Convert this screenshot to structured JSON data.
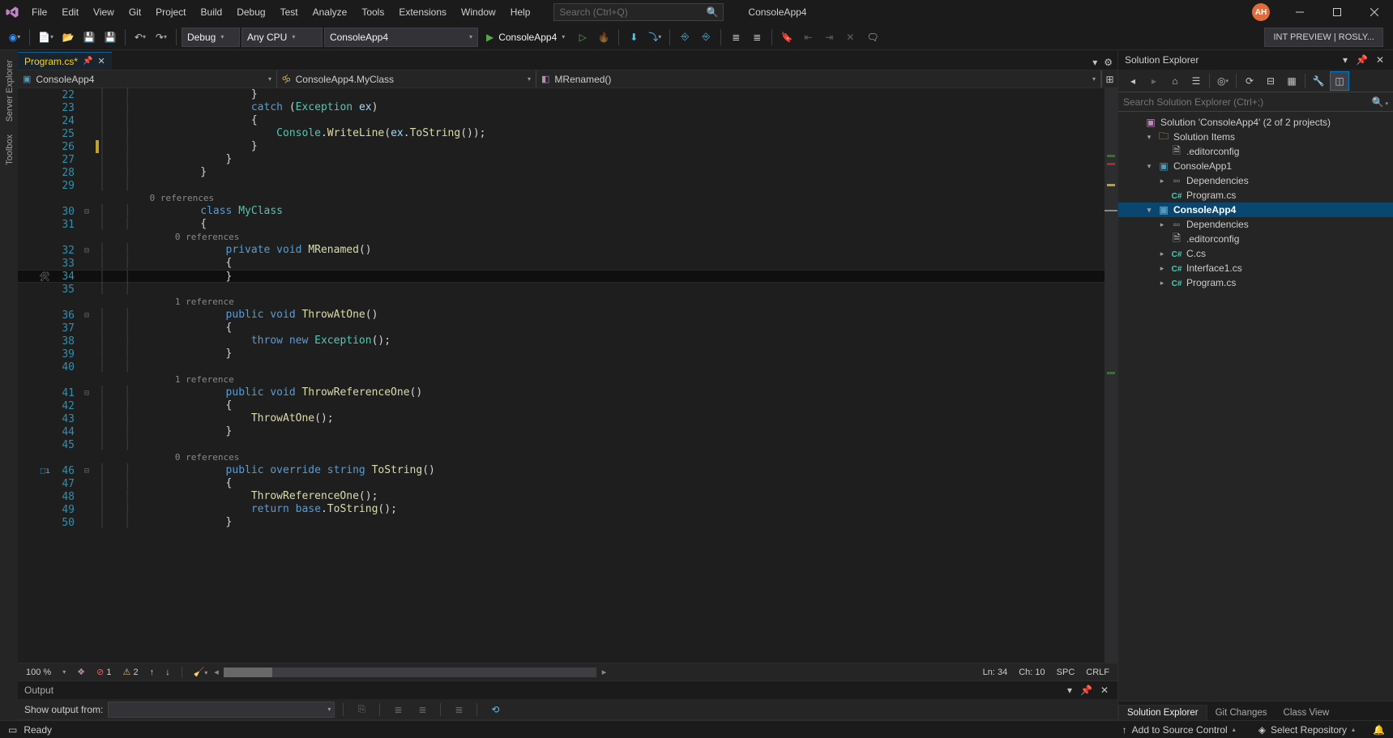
{
  "app_title": "ConsoleApp4",
  "search_placeholder": "Search (Ctrl+Q)",
  "avatar_initials": "AH",
  "preview_button": "INT PREVIEW | ROSLY...",
  "menu": [
    "File",
    "Edit",
    "View",
    "Git",
    "Project",
    "Build",
    "Debug",
    "Test",
    "Analyze",
    "Tools",
    "Extensions",
    "Window",
    "Help"
  ],
  "toolbar": {
    "config": "Debug",
    "platform": "Any CPU",
    "startup": "ConsoleApp4",
    "run": "ConsoleApp4"
  },
  "left_rail": [
    "Server Explorer",
    "Toolbox"
  ],
  "doc_tabs": {
    "active": "Program.cs*"
  },
  "nav": {
    "project": "ConsoleApp4",
    "type": "ConsoleApp4.MyClass",
    "member": "MRenamed()"
  },
  "code_lines": [
    {
      "n": 22,
      "html": "                <span class='punc'>}</span>"
    },
    {
      "n": 23,
      "html": "                <span class='kw'>catch</span> <span class='punc'>(</span><span class='type'>Exception</span> <span class='local'>ex</span><span class='punc'>)</span>"
    },
    {
      "n": 24,
      "html": "                <span class='punc'>{</span>"
    },
    {
      "n": 25,
      "html": "                    <span class='type'>Console</span><span class='punc'>.</span><span class='method'>WriteLine</span><span class='punc'>(</span><span class='local'>ex</span><span class='punc'>.</span><span class='method'>ToString</span><span class='punc'>());</span>"
    },
    {
      "n": 26,
      "html": "                <span class='punc'>}</span>",
      "mod": true
    },
    {
      "n": 27,
      "html": "            <span class='punc'>}</span>"
    },
    {
      "n": 28,
      "html": "        <span class='punc'>}</span>"
    },
    {
      "n": 29,
      "html": ""
    },
    {
      "lens": "0 references",
      "indent": 8
    },
    {
      "n": 30,
      "html": "        <span class='kw'>class</span> <span class='type'>MyClass</span>",
      "fold": true
    },
    {
      "n": 31,
      "html": "        <span class='punc'>{</span>"
    },
    {
      "lens": "0 references",
      "indent": 12
    },
    {
      "n": 32,
      "html": "            <span class='kw'>private</span> <span class='kw'>void</span> <span class='method'>MRenamed</span><span class='punc'>()</span>",
      "fold": true
    },
    {
      "n": 33,
      "html": "            <span class='punc'>{</span>"
    },
    {
      "n": 34,
      "html": "            <span class='punc'>}</span>",
      "current": true,
      "screwdriver": true
    },
    {
      "n": 35,
      "html": ""
    },
    {
      "lens": "1 reference",
      "indent": 12
    },
    {
      "n": 36,
      "html": "            <span class='kw'>public</span> <span class='kw'>void</span> <span class='method'>ThrowAtOne</span><span class='punc'>()</span>",
      "fold": true
    },
    {
      "n": 37,
      "html": "            <span class='punc'>{</span>"
    },
    {
      "n": 38,
      "html": "                <span class='kw'>throw</span> <span class='kw'>new</span> <span class='type'>Exception</span><span class='punc'>();</span>"
    },
    {
      "n": 39,
      "html": "            <span class='punc'>}</span>"
    },
    {
      "n": 40,
      "html": ""
    },
    {
      "lens": "1 reference",
      "indent": 12
    },
    {
      "n": 41,
      "html": "            <span class='kw'>public</span> <span class='kw'>void</span> <span class='method'>ThrowReferenceOne</span><span class='punc'>()</span>",
      "fold": true
    },
    {
      "n": 42,
      "html": "            <span class='punc'>{</span>"
    },
    {
      "n": 43,
      "html": "                <span class='method'>ThrowAtOne</span><span class='punc'>();</span>"
    },
    {
      "n": 44,
      "html": "            <span class='punc'>}</span>"
    },
    {
      "n": 45,
      "html": ""
    },
    {
      "lens": "0 references",
      "indent": 12
    },
    {
      "n": 46,
      "html": "            <span class='kw'>public</span> <span class='kw'>override</span> <span class='kw'>string</span> <span class='method'>ToString</span><span class='punc'>()</span>",
      "fold": true,
      "margin_icon": true
    },
    {
      "n": 47,
      "html": "            <span class='punc'>{</span>"
    },
    {
      "n": 48,
      "html": "                <span class='method'>ThrowReferenceOne</span><span class='punc'>();</span>"
    },
    {
      "n": 49,
      "html": "                <span class='kw'>return</span> <span class='kw'>base</span><span class='punc'>.</span><span class='method'>ToString</span><span class='punc'>();</span>"
    },
    {
      "n": 50,
      "html": "            <span class='punc'>}</span>"
    }
  ],
  "editor_status": {
    "zoom": "100 %",
    "errors": "1",
    "warnings": "2",
    "ln": "Ln: 34",
    "ch": "Ch: 10",
    "ins": "SPC",
    "eol": "CRLF"
  },
  "output": {
    "title": "Output",
    "label": "Show output from:"
  },
  "solution_explorer": {
    "title": "Solution Explorer",
    "search_placeholder": "Search Solution Explorer (Ctrl+;)",
    "tree": [
      {
        "depth": 0,
        "exp": "",
        "icon": "sln",
        "label": "Solution 'ConsoleApp4' (2 of 2 projects)"
      },
      {
        "depth": 1,
        "exp": "▾",
        "icon": "folder",
        "label": "Solution Items"
      },
      {
        "depth": 2,
        "exp": "",
        "icon": "file",
        "label": ".editorconfig"
      },
      {
        "depth": 1,
        "exp": "▾",
        "icon": "proj",
        "label": "ConsoleApp1"
      },
      {
        "depth": 2,
        "exp": "▸",
        "icon": "dep",
        "label": "Dependencies"
      },
      {
        "depth": 2,
        "exp": "",
        "icon": "cs",
        "label": "Program.cs"
      },
      {
        "depth": 1,
        "exp": "▾",
        "icon": "proj",
        "label": "ConsoleApp4",
        "selected": true,
        "bold": true
      },
      {
        "depth": 2,
        "exp": "▸",
        "icon": "dep",
        "label": "Dependencies"
      },
      {
        "depth": 2,
        "exp": "",
        "icon": "file",
        "label": ".editorconfig"
      },
      {
        "depth": 2,
        "exp": "▸",
        "icon": "cs",
        "label": "C.cs"
      },
      {
        "depth": 2,
        "exp": "▸",
        "icon": "cs",
        "label": "Interface1.cs"
      },
      {
        "depth": 2,
        "exp": "▸",
        "icon": "cs",
        "label": "Program.cs"
      }
    ],
    "tabs": [
      "Solution Explorer",
      "Git Changes",
      "Class View"
    ]
  },
  "statusbar": {
    "ready": "Ready",
    "source_control": "Add to Source Control",
    "repo": "Select Repository"
  }
}
